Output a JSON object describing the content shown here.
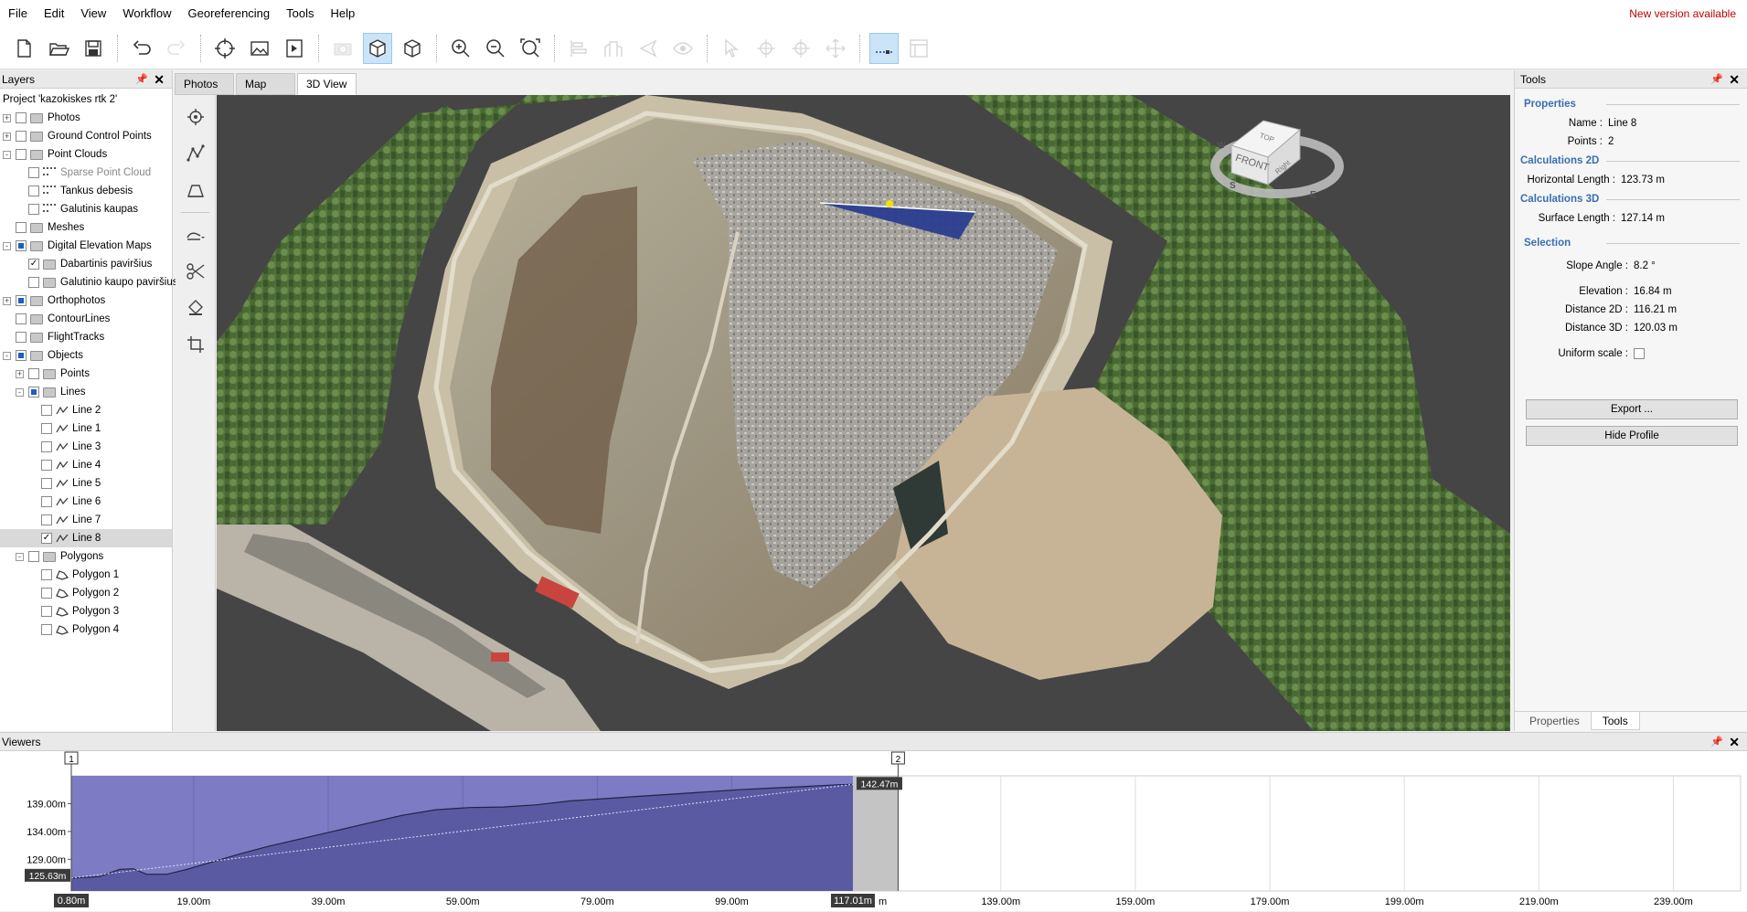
{
  "menu": {
    "items": [
      "File",
      "Edit",
      "View",
      "Workflow",
      "Georeferencing",
      "Tools",
      "Help"
    ],
    "new_version": "New version available"
  },
  "toolbar": {
    "buttons": [
      {
        "icon": "new-file-icon"
      },
      {
        "icon": "open-folder-icon"
      },
      {
        "icon": "save-icon"
      },
      {
        "icon": "undo-icon"
      },
      {
        "icon": "redo-icon"
      },
      {
        "icon": "crosshair-icon"
      },
      {
        "icon": "image-icon"
      },
      {
        "icon": "play-icon"
      },
      {
        "icon": "camera-icon"
      },
      {
        "icon": "cube-solid-icon"
      },
      {
        "icon": "cube-wire-icon"
      },
      {
        "icon": "zoom-in-icon"
      },
      {
        "icon": "zoom-out-icon"
      },
      {
        "icon": "zoom-fit-icon"
      },
      {
        "icon": "align-icon"
      },
      {
        "icon": "building-icon"
      },
      {
        "icon": "plane-icon"
      },
      {
        "icon": "eye-icon"
      },
      {
        "icon": "select-arrow-icon"
      },
      {
        "icon": "add-point-icon"
      },
      {
        "icon": "remove-point-icon"
      },
      {
        "icon": "move-point-icon"
      },
      {
        "icon": "measure-icon"
      },
      {
        "icon": "window-icon"
      }
    ]
  },
  "layers": {
    "title": "Layers",
    "tree": [
      {
        "label": "Project 'kazokiskes rtk 2'",
        "indent": 0,
        "expander": "",
        "check": "",
        "icon": "none"
      },
      {
        "label": "Photos",
        "indent": 0,
        "expander": "+",
        "check": "empty",
        "icon": "folder"
      },
      {
        "label": "Ground Control Points",
        "indent": 0,
        "expander": "+",
        "check": "empty",
        "icon": "folder"
      },
      {
        "label": "Point Clouds",
        "indent": 0,
        "expander": "-",
        "check": "empty",
        "icon": "folder"
      },
      {
        "label": "Sparse Point Cloud",
        "indent": 2,
        "expander": "",
        "check": "empty",
        "icon": "points",
        "dim": true
      },
      {
        "label": "Tankus debesis",
        "indent": 2,
        "expander": "",
        "check": "empty",
        "icon": "points"
      },
      {
        "label": "Galutinis kaupas",
        "indent": 2,
        "expander": "",
        "check": "empty",
        "icon": "points"
      },
      {
        "label": "Meshes",
        "indent": 0,
        "expander": "",
        "check": "empty",
        "icon": "folder"
      },
      {
        "label": "Digital Elevation Maps",
        "indent": 0,
        "expander": "-",
        "check": "partial",
        "icon": "folder"
      },
      {
        "label": "Dabartinis paviršius",
        "indent": 2,
        "expander": "",
        "check": "checked",
        "icon": "folder"
      },
      {
        "label": "Galutinio kaupo paviršius",
        "indent": 2,
        "expander": "",
        "check": "empty",
        "icon": "folder"
      },
      {
        "label": "Orthophotos",
        "indent": 0,
        "expander": "+",
        "check": "partial",
        "icon": "folder"
      },
      {
        "label": "ContourLines",
        "indent": 0,
        "expander": "",
        "check": "empty",
        "icon": "folder"
      },
      {
        "label": "FlightTracks",
        "indent": 0,
        "expander": "",
        "check": "empty",
        "icon": "folder"
      },
      {
        "label": "Objects",
        "indent": 0,
        "expander": "-",
        "check": "partial",
        "icon": "folder"
      },
      {
        "label": "Points",
        "indent": 1,
        "expander": "+",
        "check": "empty",
        "icon": "folder"
      },
      {
        "label": "Lines",
        "indent": 1,
        "expander": "-",
        "check": "partial",
        "icon": "folder"
      },
      {
        "label": "Line 2",
        "indent": 3,
        "expander": "",
        "check": "empty",
        "icon": "line"
      },
      {
        "label": "Line 1",
        "indent": 3,
        "expander": "",
        "check": "empty",
        "icon": "line"
      },
      {
        "label": "Line 3",
        "indent": 3,
        "expander": "",
        "check": "empty",
        "icon": "line"
      },
      {
        "label": "Line 4",
        "indent": 3,
        "expander": "",
        "check": "empty",
        "icon": "line"
      },
      {
        "label": "Line 5",
        "indent": 3,
        "expander": "",
        "check": "empty",
        "icon": "line"
      },
      {
        "label": "Line 6",
        "indent": 3,
        "expander": "",
        "check": "empty",
        "icon": "line"
      },
      {
        "label": "Line 7",
        "indent": 3,
        "expander": "",
        "check": "empty",
        "icon": "line"
      },
      {
        "label": "Line 8",
        "indent": 3,
        "expander": "",
        "check": "checked",
        "icon": "line",
        "selected": true
      },
      {
        "label": "Polygons",
        "indent": 1,
        "expander": "-",
        "check": "empty",
        "icon": "folder"
      },
      {
        "label": "Polygon 1",
        "indent": 3,
        "expander": "",
        "check": "empty",
        "icon": "polygon"
      },
      {
        "label": "Polygon 2",
        "indent": 3,
        "expander": "",
        "check": "empty",
        "icon": "polygon"
      },
      {
        "label": "Polygon 3",
        "indent": 3,
        "expander": "",
        "check": "empty",
        "icon": "polygon"
      },
      {
        "label": "Polygon 4",
        "indent": 3,
        "expander": "",
        "check": "empty",
        "icon": "polygon"
      }
    ]
  },
  "view_tabs": [
    {
      "label": "Photos",
      "active": false
    },
    {
      "label": "Map",
      "active": false
    },
    {
      "label": "3D View",
      "active": true
    }
  ],
  "view_tools": [
    {
      "icon": "target-icon"
    },
    {
      "icon": "polyline-icon"
    },
    {
      "icon": "volume-icon"
    },
    {
      "icon": "surface-dropdown-icon"
    },
    {
      "icon": "cut-icon"
    },
    {
      "icon": "fill-icon"
    },
    {
      "icon": "crop-icon"
    }
  ],
  "nav_cube": {
    "top": "TOP",
    "front": "FRONT",
    "right": "Right",
    "w": "W",
    "s": "S",
    "e": "E"
  },
  "tools_panel": {
    "title": "Tools",
    "properties_title": "Properties",
    "name_key": "Name :",
    "name_val": "Line 8",
    "points_key": "Points :",
    "points_val": "2",
    "calc2d_title": "Calculations 2D",
    "hlen_key": "Horizontal Length :",
    "hlen_val": "123.73 m",
    "calc3d_title": "Calculations 3D",
    "slen_key": "Surface Length :",
    "slen_val": "127.14 m",
    "selection_title": "Selection",
    "slope_key": "Slope Angle :",
    "slope_val": "8.2 °",
    "elev_key": "Elevation :",
    "elev_val": "16.84 m",
    "d2_key": "Distance 2D :",
    "d2_val": "116.21 m",
    "d3_key": "Distance 3D :",
    "d3_val": "120.03 m",
    "uniform_key": "Uniform scale :",
    "export_label": "Export ...",
    "hide_label": "Hide Profile",
    "tab_properties": "Properties",
    "tab_tools": "Tools"
  },
  "viewers": {
    "title": "Viewers",
    "marker_start": "1",
    "marker_end": "2",
    "end_value_label": "142.47m",
    "start_value_label": "125.63m",
    "y_ticks": [
      "139.00m",
      "134.00m",
      "129.00m"
    ],
    "x_ticks": [
      "19.00m",
      "39.00m",
      "59.00m",
      "79.00m",
      "99.00m",
      "139.00m",
      "159.00m",
      "179.00m",
      "199.00m",
      "219.00m",
      "239.00m"
    ],
    "x_start_label": "0.80m",
    "x_sel_label": "117.01m",
    "x_hidden_suffix": "m"
  },
  "chart_data": {
    "type": "area",
    "title": "",
    "xlabel": "",
    "ylabel": "",
    "x": [
      0.8,
      5,
      8,
      10,
      12,
      15,
      18,
      22,
      26,
      30,
      35,
      40,
      45,
      50,
      55,
      60,
      65,
      70,
      75,
      80,
      85,
      90,
      95,
      100,
      105,
      110,
      115,
      117.01
    ],
    "series": [
      {
        "values": [
          125.6,
          125.9,
          127.2,
          127.3,
          126.3,
          126.3,
          127.2,
          128.6,
          130.0,
          131.3,
          132.7,
          134.1,
          135.5,
          136.9,
          137.9,
          138.3,
          138.4,
          138.8,
          139.5,
          139.9,
          140.3,
          140.7,
          141.1,
          141.5,
          141.8,
          142.1,
          142.4,
          142.47
        ]
      }
    ],
    "reference_line": {
      "from": [
        0.8,
        125.63
      ],
      "to": [
        117.01,
        142.47
      ]
    },
    "xlim": [
      0.8,
      249
    ],
    "ylim": [
      123.3,
      144.0
    ],
    "selection_end": 117.01,
    "gap_end": 123.73
  }
}
